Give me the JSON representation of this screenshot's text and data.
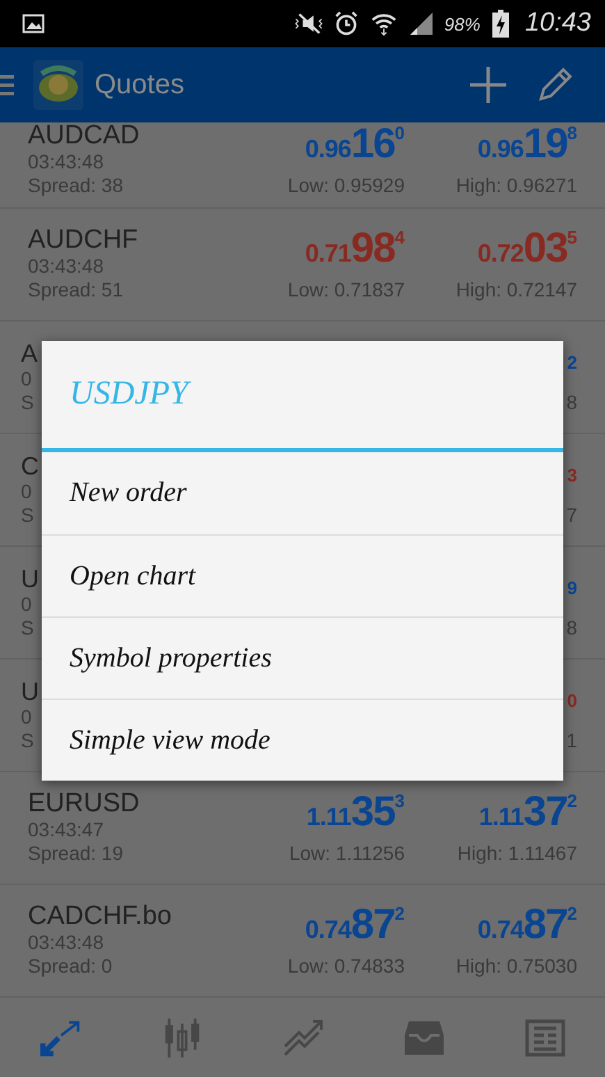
{
  "status_bar": {
    "battery": "98%",
    "time": "10:43"
  },
  "app_bar": {
    "title": "Quotes"
  },
  "quotes": [
    {
      "kind": "full",
      "symbol": "AUDCAD",
      "time": "03:43:48",
      "spread": "Spread: 38",
      "color": "#0a4592",
      "bid": {
        "prefix": "0.96",
        "big": "16",
        "sup": "0"
      },
      "ask": {
        "prefix": "0.96",
        "big": "19",
        "sup": "8"
      },
      "low": "Low: 0.95929",
      "high": "High: 0.96271"
    },
    {
      "kind": "full",
      "symbol": "AUDCHF",
      "time": "03:43:48",
      "spread": "Spread: 51",
      "color": "#882a22",
      "bid": {
        "prefix": "0.71",
        "big": "98",
        "sup": "4"
      },
      "ask": {
        "prefix": "0.72",
        "big": "03",
        "sup": "5"
      },
      "low": "Low: 0.71837",
      "high": "High: 0.72147"
    },
    {
      "kind": "covered",
      "symbol": "A",
      "time": "0",
      "spread": "S",
      "color": "#0a4592",
      "ask_sup": "2",
      "high": "8"
    },
    {
      "kind": "covered",
      "symbol": "C",
      "time": "0",
      "spread": "S",
      "color": "#882a22",
      "ask_sup": "3",
      "high": "7"
    },
    {
      "kind": "covered",
      "symbol": "U",
      "time": "0",
      "spread": "S",
      "color": "#0a4592",
      "ask_sup": "9",
      "high": "8"
    },
    {
      "kind": "covered",
      "symbol": "U",
      "time": "0",
      "spread": "S",
      "color": "#882a22",
      "ask_sup": "0",
      "high": "1"
    },
    {
      "kind": "full",
      "symbol": "EURUSD",
      "time": "03:43:47",
      "spread": "Spread: 19",
      "color": "#0a4592",
      "bid": {
        "prefix": "1.11",
        "big": "35",
        "sup": "3"
      },
      "ask": {
        "prefix": "1.11",
        "big": "37",
        "sup": "2"
      },
      "low": "Low: 1.11256",
      "high": "High: 1.11467"
    },
    {
      "kind": "full",
      "symbol": "CADCHF.bo",
      "time": "03:43:48",
      "spread": "Spread: 0",
      "color": "#0a4592",
      "bid": {
        "prefix": "0.74",
        "big": "87",
        "sup": "2"
      },
      "ask": {
        "prefix": "0.74",
        "big": "87",
        "sup": "2"
      },
      "low": "Low: 0.74833",
      "high": "High: 0.75030"
    }
  ],
  "dialog": {
    "title": "USDJPY",
    "items": [
      "New order",
      "Open chart",
      "Symbol properties",
      "Simple view mode"
    ]
  },
  "bottom_nav": [
    {
      "kind": "quotes",
      "selected": true
    },
    {
      "kind": "chart",
      "selected": false
    },
    {
      "kind": "trade",
      "selected": false
    },
    {
      "kind": "history",
      "selected": false
    },
    {
      "kind": "news",
      "selected": false
    }
  ]
}
